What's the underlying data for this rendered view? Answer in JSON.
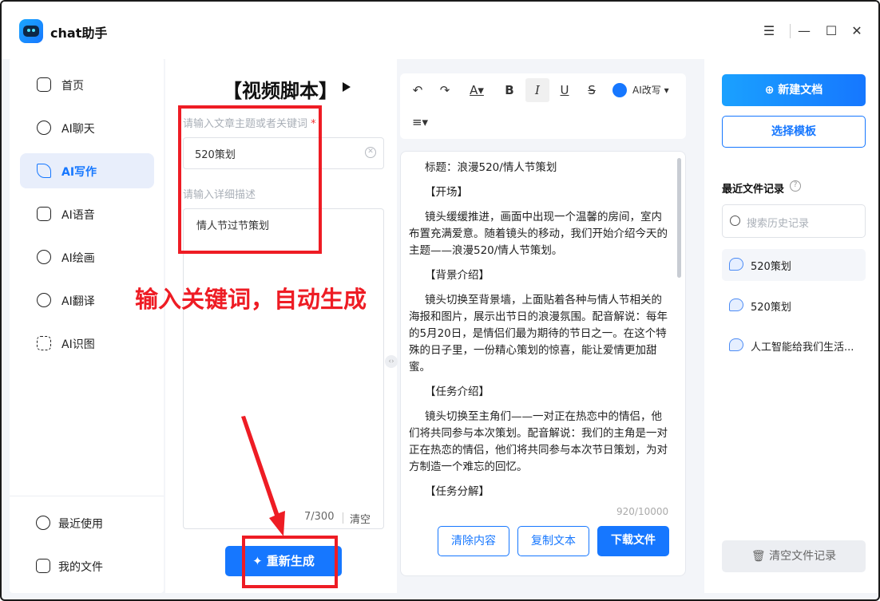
{
  "app": {
    "title": "chat助手"
  },
  "sidebar": {
    "items": [
      {
        "label": "首页",
        "icon": "home-icon"
      },
      {
        "label": "AI聊天",
        "icon": "chat-icon"
      },
      {
        "label": "AI写作",
        "icon": "pen-icon",
        "active": true
      },
      {
        "label": "AI语音",
        "icon": "audio-icon"
      },
      {
        "label": "AI绘画",
        "icon": "palette-icon"
      },
      {
        "label": "AI翻译",
        "icon": "translate-icon"
      },
      {
        "label": "AI识图",
        "icon": "scan-icon"
      }
    ],
    "bottom": [
      {
        "label": "最近使用",
        "icon": "history-icon"
      },
      {
        "label": "我的文件",
        "icon": "file-icon"
      }
    ]
  },
  "form": {
    "title": "【视频脚本】",
    "keyword_label": "请输入文章主题或者关键词",
    "required_mark": "*",
    "keyword_value": "520策划",
    "desc_label": "请输入详细描述",
    "desc_value": "情人节过节策划",
    "counter": "7/300",
    "clear_label": "清空",
    "regen_label": "重新生成",
    "annotation": "输入关键词，自动生成"
  },
  "toolbar": {
    "ai_rewrite_label": "AI改写"
  },
  "editor": {
    "paragraphs": [
      "标题：浪漫520/情人节策划",
      "【开场】",
      "镜头缓缓推进，画面中出现一个温馨的房间，室内布置充满爱意。随着镜头的移动，我们开始介绍今天的主题——浪漫520/情人节策划。",
      "【背景介绍】",
      "镜头切换至背景墙，上面贴着各种与情人节相关的海报和图片，展示出节日的浪漫氛围。配音解说：每年的5月20日，是情侣们最为期待的节日之一。在这个特殊的日子里，一份精心策划的惊喜，能让爱情更加甜蜜。",
      "【任务介绍】",
      "镜头切换至主角们——一对正在热恋中的情侣，他们将共同参与本次策划。配音解说：我们的主角是一对正在热恋的情侣，他们将共同参与本次节日策划，为对方制造一个难忘的回忆。",
      "【任务分解】"
    ],
    "word_count": "920/10000",
    "clear_btn": "清除内容",
    "copy_btn": "复制文本",
    "download_btn": "下载文件"
  },
  "right": {
    "new_doc": "新建文档",
    "template": "选择模板",
    "recent_title": "最近文件记录",
    "search_placeholder": "搜索历史记录",
    "files": [
      "520策划",
      "520策划",
      "人工智能给我们生活..."
    ],
    "clear_records": "清空文件记录"
  },
  "colors": {
    "accent": "#1677ff",
    "annotation": "#ee1c24"
  }
}
